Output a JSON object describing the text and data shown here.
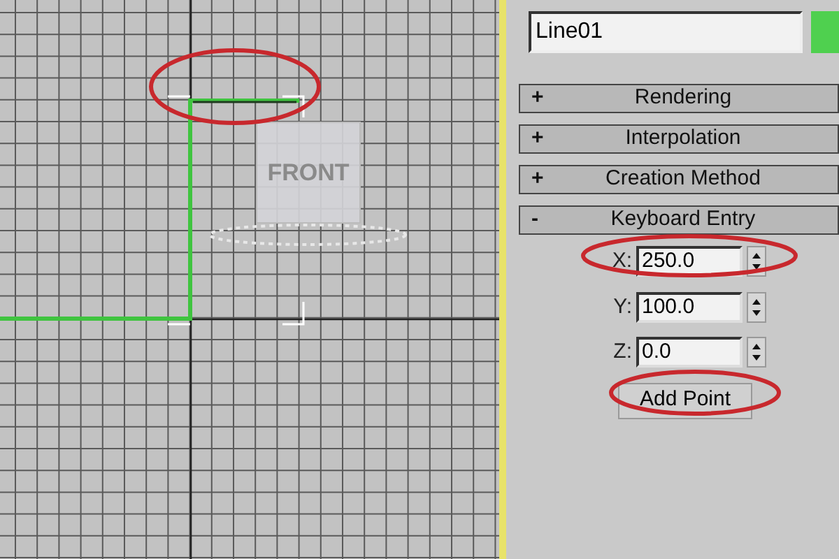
{
  "viewport": {
    "viewcube_label": "FRONT"
  },
  "object_name": {
    "value": "Line01",
    "color": "#4fd04f"
  },
  "rollouts": [
    {
      "sign": "+",
      "title": "Rendering"
    },
    {
      "sign": "+",
      "title": "Interpolation"
    },
    {
      "sign": "+",
      "title": "Creation Method"
    },
    {
      "sign": "-",
      "title": "Keyboard Entry"
    }
  ],
  "keyboard_entry": {
    "fields": [
      {
        "label": "X:",
        "value": "250.0"
      },
      {
        "label": "Y:",
        "value": "100.0"
      },
      {
        "label": "Z:",
        "value": "0.0"
      }
    ],
    "button": "Add Point"
  }
}
